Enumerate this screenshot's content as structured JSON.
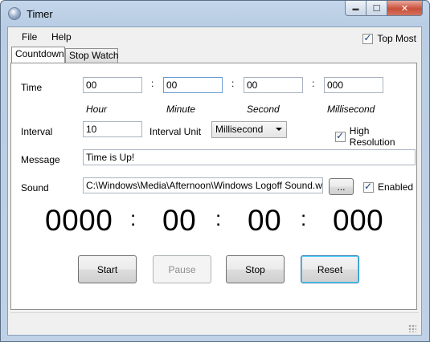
{
  "window": {
    "title": "Timer",
    "min_glyph": "▬",
    "max_glyph": "☐",
    "close_glyph": "✕"
  },
  "menu": {
    "items": [
      "File",
      "Help"
    ],
    "top_most": {
      "label": "Top Most",
      "checked": true
    }
  },
  "tabs": [
    {
      "label": "Countdown",
      "active": true
    },
    {
      "label": "Stop Watch",
      "active": false
    }
  ],
  "countdown": {
    "time_label": "Time",
    "separator": ":",
    "fields": {
      "hour": "00",
      "minute": "00",
      "second": "00",
      "millisecond": "000"
    },
    "units": {
      "hour": "Hour",
      "minute": "Minute",
      "second": "Second",
      "millisecond": "Millisecond"
    },
    "interval_label": "Interval",
    "interval_value": "10",
    "interval_unit_label": "Interval Unit",
    "interval_unit_value": "Millisecond",
    "high_resolution": {
      "label": "High Resolution",
      "checked": true
    },
    "message_label": "Message",
    "message_value": "Time is Up!",
    "sound_label": "Sound",
    "sound_path": "C:\\Windows\\Media\\Afternoon\\Windows Logoff Sound.wav",
    "browse_label": "...",
    "enabled": {
      "label": "Enabled",
      "checked": true
    },
    "display": {
      "hours": "0000",
      "minutes": "00",
      "seconds": "00",
      "milliseconds": "000"
    },
    "buttons": {
      "start": "Start",
      "pause": "Pause",
      "stop": "Stop",
      "reset": "Reset"
    }
  }
}
